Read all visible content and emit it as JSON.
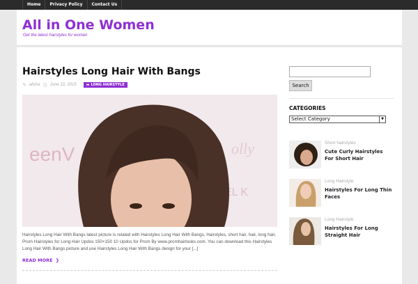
{
  "nav": {
    "items": [
      "Home",
      "Privacy Policy",
      "Contact Us"
    ]
  },
  "header": {
    "site_title": "All in One Women",
    "tagline": "Get the latest hairstyles for women"
  },
  "post": {
    "title": "Hairstyles Long Hair With Bangs",
    "author": "alisha",
    "date": "June 10, 2015",
    "category": "LONG HAIRSTYLE",
    "excerpt": "Hairstyles Long Hair With Bangs latest picture is related with Hairstyles Long Hair With Bangs, Hairstyles, short hair, hair, long hair, Prom Hairstyles for Long Hair Updos 150×150 10 Updos for Prom By www.promhairlooks.com. You can download this Hairstyles Long Hair With Bangs picture and use Hairstyles Long Hair With Bangs design for your [...]",
    "read_more": "READ MORE"
  },
  "sidebar": {
    "search_button": "Search",
    "search_value": "",
    "categories_heading": "CATEGORIES",
    "select_value": "Select Category",
    "posts": [
      {
        "category": "Short hairstyles",
        "title": "Cute Curly Hairstyles For Short Hair"
      },
      {
        "category": "Long Hairstyle",
        "title": "Hairstyles For Long Thin Faces"
      },
      {
        "category": "Long Hairstyle",
        "title": "Hairstyles For Long Straight Hair"
      }
    ]
  },
  "colors": {
    "accent": "#8e2fd4",
    "topbar": "#2b2b2b",
    "background": "#e9e9e9"
  }
}
